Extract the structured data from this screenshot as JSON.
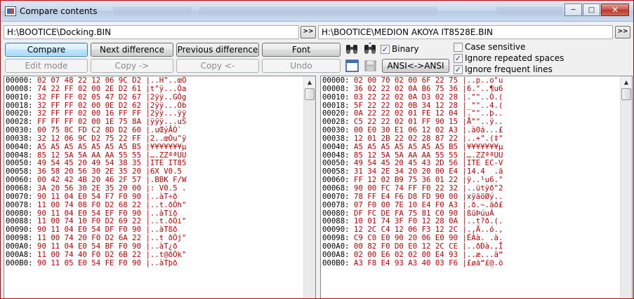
{
  "title": "Compare contents",
  "window_buttons": {
    "minimize": "─",
    "maximize": "□",
    "close": "✕"
  },
  "left_path": "H:\\BOOTICE\\Docking.BIN",
  "right_path": "H:\\BOOTICE\\MEDION AKOYA IT8528E.BIN",
  "browse_label": ">>",
  "buttons": {
    "compare": "Compare",
    "next_diff": "Next difference",
    "prev_diff": "Previous difference",
    "font": "Font",
    "edit_mode": "Edit mode",
    "copy_right": "Copy ->",
    "copy_left": "Copy <-",
    "undo": "Undo",
    "ansi": "ANSI<->ANSI"
  },
  "options": {
    "binary": {
      "label": "Binary",
      "checked": true
    },
    "case_sensitive": {
      "label": "Case sensitive",
      "checked": false
    },
    "ignore_repeated_spaces": {
      "label": "Ignore repeated spaces",
      "checked": true
    },
    "ignore_frequent_lines": {
      "label": "Ignore frequent lines",
      "checked": true
    }
  },
  "colors": {
    "diff_hex": "#c00000",
    "titlebar": "#c6d7ec",
    "window_border": "#c00000"
  },
  "left_hex": [
    [
      "00000:",
      "02 07 48 22 12 06 9C D2",
      "|..H\"..œÒ"
    ],
    [
      "00008:",
      "74 22 FF 02 00 2E D2 61",
      "|t\"ÿ...Òa"
    ],
    [
      "00010:",
      "32 FF FF 02 05 47 D2 67",
      "|2ÿÿ..GÒg"
    ],
    [
      "00018:",
      "32 FF FF 02 00 0E D2 62",
      "|2ÿÿ...Òb"
    ],
    [
      "00020:",
      "32 FF FF 02 00 16 FF FF",
      "|2ÿÿ...ÿÿ"
    ],
    [
      "00028:",
      "FF FF FF 02 00 1E 75 8A",
      "|ÿÿÿ...uŠ"
    ],
    [
      "00030:",
      "00 75 8C FD C2 8D D2 60",
      "|.uŒýÂÒ`"
    ],
    [
      "00038:",
      "32 12 06 9C D2 75 22 FF",
      "|2..œÒu\"ÿ"
    ],
    [
      "00040:",
      "A5 A5 A5 A5 A5 A5 A5 B5",
      "|¥¥¥¥¥¥¥µ"
    ],
    [
      "00048:",
      "85 12 5A 5A AA AA 55 55",
      "|….ZZªªUU"
    ],
    [
      "00050:",
      "49 54 45 20 49 54 38 35",
      "|ITE IT85"
    ],
    [
      "00058:",
      "36 58 20 56 30 2E 35 20",
      "|6X V0.5"
    ],
    [
      "00060:",
      "00 42 42 4B 20 46 2F 57",
      "|.BBK F/W"
    ],
    [
      "00068:",
      "3A 20 56 30 2E 35 20 00",
      "|: V0.5 ."
    ],
    [
      "00070:",
      "90 11 04 E0 54 F7 F0 90",
      "|..àT÷ð"
    ],
    [
      "00078:",
      "11 00 74 08 F0 D2 68 22",
      "|..t.ðÒh\""
    ],
    [
      "00080:",
      "90 11 04 E0 54 EF F0 90",
      "|..àTïð"
    ],
    [
      "00088:",
      "11 00 74 10 F0 D2 69 22",
      "|..t.ðÒi\""
    ],
    [
      "00090:",
      "90 11 04 E0 54 DF F0 90",
      "|..àTßð"
    ],
    [
      "00098:",
      "11 00 74 20 F0 D2 6A 22",
      "|..t ðÒj\""
    ],
    [
      "000A0:",
      "90 11 04 E0 54 BF F0 90",
      "|..àT¿ð"
    ],
    [
      "000A8:",
      "11 00 74 40 F0 D2 6B 22",
      "|..t@ðÒk\""
    ],
    [
      "000B0:",
      "90 11 05 E0 54 FE F0 90",
      "|..àTþð"
    ]
  ],
  "right_hex": [
    [
      "00000:",
      "02 00 70 02 00 6F 22 75",
      "|..p..o\"u"
    ],
    [
      "00008:",
      "36 02 22 02 0A B6 75 36",
      "|6.\"..¶u6"
    ],
    [
      "00010:",
      "03 22 22 02 0A D3 02 28",
      "|.\"\"..Ó.("
    ],
    [
      "00018:",
      "5F 22 22 02 0B 34 12 28",
      "|_\"\"..4.("
    ],
    [
      "00020:",
      "0A 22 22 02 01 FE 12 04",
      "|.\"\"..þ.."
    ],
    [
      "00028:",
      "C5 22 22 02 01 FF 90 15",
      "|Å\"\"..ÿ.."
    ],
    [
      "00030:",
      "00 E0 30 E1 06 12 02 A3",
      "|.à0á...£"
    ],
    [
      "00038:",
      "12 01 2B 22 02 28 87 22",
      "|..+\".(‡\""
    ],
    [
      "00040:",
      "A5 A5 A5 A5 A5 A5 A5 B5",
      "|¥¥¥¥¥¥¥µ"
    ],
    [
      "00048:",
      "85 12 5A 5A AA AA 55 55",
      "|….ZZªªUU"
    ],
    [
      "00050:",
      "49 54 45 20 45 43 2D 56",
      "|ITE EC-V"
    ],
    [
      "00058:",
      "31 34 2E 34 20 20 00 E4",
      "|14.4  .ä"
    ],
    [
      "00060:",
      "FF 12 02 B9 75 36 01 22",
      "|ÿ..¹u6.\""
    ],
    [
      "00068:",
      "90 00 FC 74 FF F0 22 32",
      "|..ütÿð\"2"
    ],
    [
      "00070:",
      "78 FF E4 F6 D8 FD 90 00",
      "|xÿäöØý.."
    ],
    [
      "00078:",
      "07 F0 00 7E 10 E4 F0 A3",
      "|.ð.~.äð£"
    ],
    [
      "00080:",
      "DF FC DE FA 75 81 C0 90",
      "|ßüÞúuÀ"
    ],
    [
      "00088:",
      "10 01 74 3F F0 12 28 0A",
      "|..t?ð.(."
    ],
    [
      "00090:",
      "12 2C C4 12 06 F3 12 2C",
      "|.,Ä..ó.,"
    ],
    [
      "00098:",
      "C9 C0 E0 90 20 06 E0 90",
      "|ÉÀà. .à."
    ],
    [
      "000A0:",
      "00 82 F0 D0 E0 12 2C CE",
      "|..ðÐà.,Î"
    ],
    [
      "000A8:",
      "02 00 E6 02 02 00 E4 93",
      "|..æ...ä“"
    ],
    [
      "000B0:",
      "A3 F8 E4 93 A3 40 03 F6",
      "|£øä“£@.ö"
    ]
  ]
}
